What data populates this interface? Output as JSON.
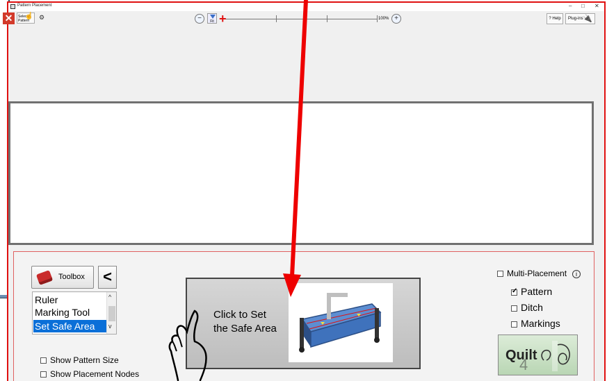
{
  "window": {
    "title": "Pattern Placement",
    "controls": {
      "minimize": "–",
      "maximize": "□",
      "close": "✕"
    }
  },
  "toolbar": {
    "close_icon": "✕",
    "select_pattern": "Select Pattern",
    "zoom_fit": "Fit",
    "zoom_100": "100%",
    "help": "? Help",
    "plugins": "Plug-ins"
  },
  "panel": {
    "toolbox_label": "Toolbox",
    "back_label": "<",
    "tool_list": [
      "Ruler",
      "Marking Tool",
      "Set Safe Area"
    ],
    "selected_tool": "Set Safe Area",
    "show_pattern_size": "Show Pattern Size",
    "show_placement_nodes": "Show Placement Nodes",
    "safe_area_button": "Click to Set\nthe Safe Area",
    "multi_placement": "Multi-Placement",
    "multi_placement_checked": false,
    "multi_info": "i",
    "options": [
      {
        "label": "Pattern",
        "checked": true
      },
      {
        "label": "Ditch",
        "checked": false
      },
      {
        "label": "Markings",
        "checked": false
      }
    ],
    "quilt_label": "Quilt",
    "quilt_number": "4"
  },
  "colors": {
    "accent_red": "#e01010",
    "selection_blue": "#0a6fd8",
    "quilt_green": "#c4dfbf"
  },
  "icons": [
    "close-icon",
    "hand-icon",
    "zoom-out-icon",
    "zoom-in-icon",
    "plug-icon",
    "toolbox-icon",
    "pointing-hand-icon",
    "info-icon"
  ]
}
